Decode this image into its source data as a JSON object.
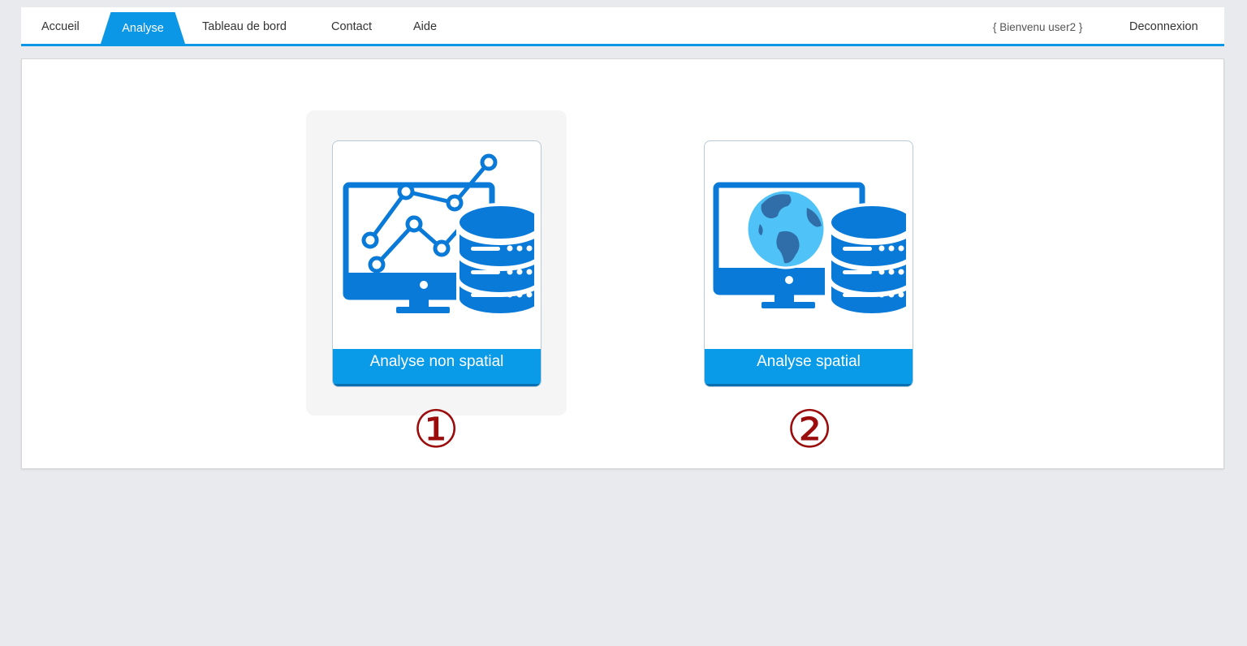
{
  "nav": {
    "items": [
      "Accueil",
      "Analyse",
      "Tableau de bord",
      "Contact",
      "Aide"
    ],
    "active": "Analyse",
    "welcome": "{ Bienvenu user2 }",
    "logout": "Deconnexion"
  },
  "cards": [
    {
      "label": "Analyse non spatial",
      "icon": "chart-database-icon",
      "marker": "①"
    },
    {
      "label": "Analyse spatial",
      "icon": "globe-database-icon",
      "marker": "②"
    }
  ],
  "colors": {
    "accent": "#0b96e6",
    "card_label_bg": "#0a9be8",
    "icon_blue": "#0a7ad8",
    "globe_light": "#4fc3f7",
    "marker_red": "#9b0c0c",
    "page_bg": "#e9eaed"
  }
}
